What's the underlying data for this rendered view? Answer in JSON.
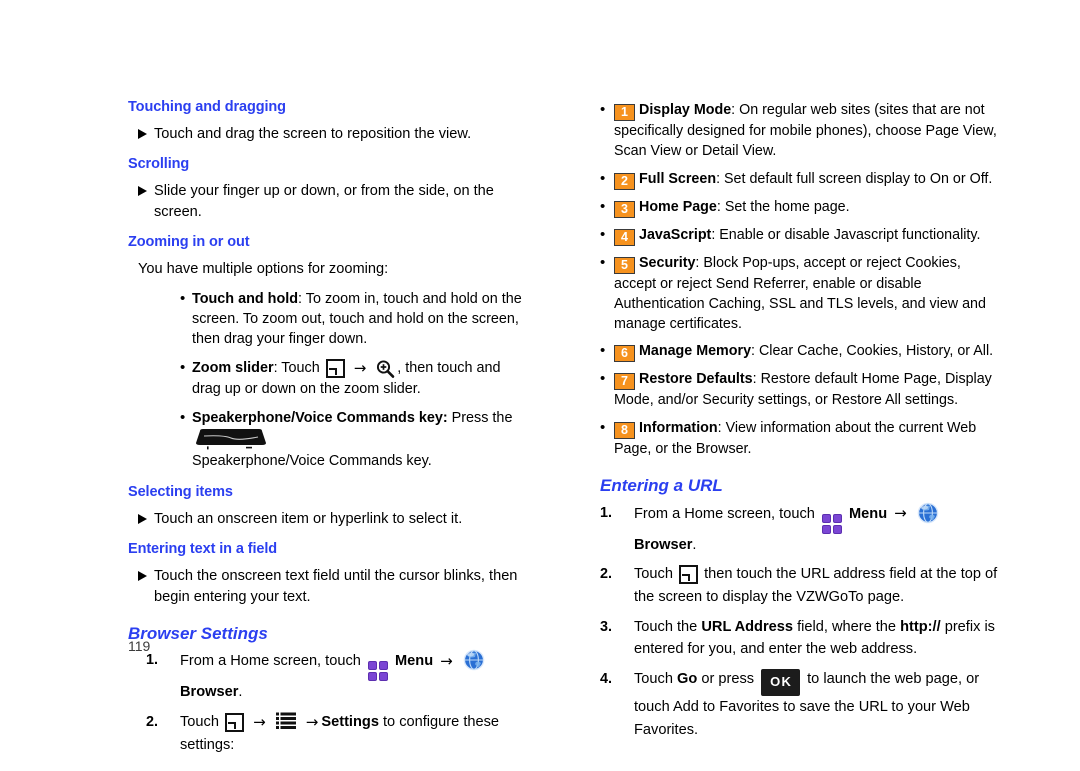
{
  "page": {
    "number": "119"
  },
  "icons": {
    "window": "window-icon",
    "zoom_in": "magnifier-plus-icon",
    "menu": "menu-grid-icon",
    "browser": "browser-globe-icon",
    "settings_list": "settings-list-icon",
    "speakerphone_key": "speakerphone-voice-commands-key-icon",
    "ok_key": "OK",
    "arrow": "→",
    "triangle_bullet": "▶",
    "dot_bullet": "•"
  },
  "colors": {
    "heading_blue": "#2b3ff0",
    "badge_orange": "#f6921e",
    "menu_purple": "#7b46d4",
    "ok_key_black": "#1c1c1c"
  },
  "left_column": {
    "touching_and_dragging": {
      "heading": "Touching and dragging",
      "bullet": "Touch and drag the screen to reposition the view."
    },
    "scrolling": {
      "heading": "Scrolling",
      "bullet": "Slide your finger up or down, or from the side, on the screen."
    },
    "zooming": {
      "heading": "Zooming in or out",
      "intro": "You have multiple options for zooming:",
      "items": [
        {
          "label": "Touch and hold",
          "text": ": To zoom in, touch and hold on the screen. To zoom out, touch and hold on the screen, then drag your finger down."
        },
        {
          "label": "Zoom slider",
          "text_before": ": Touch",
          "text_after": ", then touch and drag up or down on the zoom slider."
        },
        {
          "label": "Speakerphone/Voice Commands key:",
          "text_before": " Press the",
          "text_after": "Speakerphone/Voice Commands key."
        }
      ]
    },
    "selecting_items": {
      "heading": "Selecting items",
      "bullet": "Touch an onscreen item or hyperlink to select it."
    },
    "entering_text": {
      "heading": "Entering text in a field",
      "bullet": "Touch the onscreen text field until the cursor blinks, then begin entering your text."
    },
    "browser_settings": {
      "heading": "Browser Settings",
      "steps": [
        {
          "number": "1.",
          "part1": "From a Home screen, touch",
          "menu_label": "Menu",
          "browser_label": "Browser",
          "part_end": "."
        },
        {
          "number": "2.",
          "part1": "Touch",
          "settings_label": "Settings",
          "part_end": "to configure these settings:"
        }
      ]
    }
  },
  "right_column": {
    "settings_list": [
      {
        "badge": "1",
        "label": "Display Mode",
        "text": ": On regular web sites (sites that are not specifically designed for mobile phones), choose Page View, Scan View or Detail View."
      },
      {
        "badge": "2",
        "label": "Full Screen",
        "text": ": Set default full screen display to On or Off."
      },
      {
        "badge": "3",
        "label": "Home Page",
        "text": ": Set the home page."
      },
      {
        "badge": "4",
        "label": "JavaScript",
        "text": ": Enable or disable Javascript functionality."
      },
      {
        "badge": "5",
        "label": "Security",
        "text": ": Block Pop-ups, accept or reject Cookies, accept or reject Send Referrer, enable or disable Authentication Caching, SSL and TLS levels, and view and manage certificates."
      },
      {
        "badge": "6",
        "label": "Manage Memory",
        "text": ": Clear Cache, Cookies, History, or All."
      },
      {
        "badge": "7",
        "label": "Restore Defaults",
        "text": ": Restore default Home Page, Display Mode, and/or Security settings, or Restore All settings."
      },
      {
        "badge": "8",
        "label": "Information",
        "text": ": View information about the current Web Page, or the Browser."
      }
    ],
    "entering_a_url": {
      "heading": "Entering a URL",
      "steps": [
        {
          "number": "1.",
          "part1": "From a Home screen, touch",
          "menu_label": "Menu",
          "browser_label": "Browser",
          "part_end": "."
        },
        {
          "number": "2.",
          "part1": "Touch",
          "part_end": "then touch the URL address field at the top of the screen to display the VZWGoTo page."
        },
        {
          "number": "3.",
          "part1": "Touch the",
          "bold1": "URL Address",
          "part2": "field, where the",
          "bold2": "http://",
          "part3": "prefix is entered for you, and enter the web address."
        },
        {
          "number": "4.",
          "part1": "Touch",
          "bold1": "Go",
          "part2": "or press",
          "part3": "to launch the web page, or touch Add to Favorites to save the URL to your Web Favorites."
        }
      ]
    }
  }
}
